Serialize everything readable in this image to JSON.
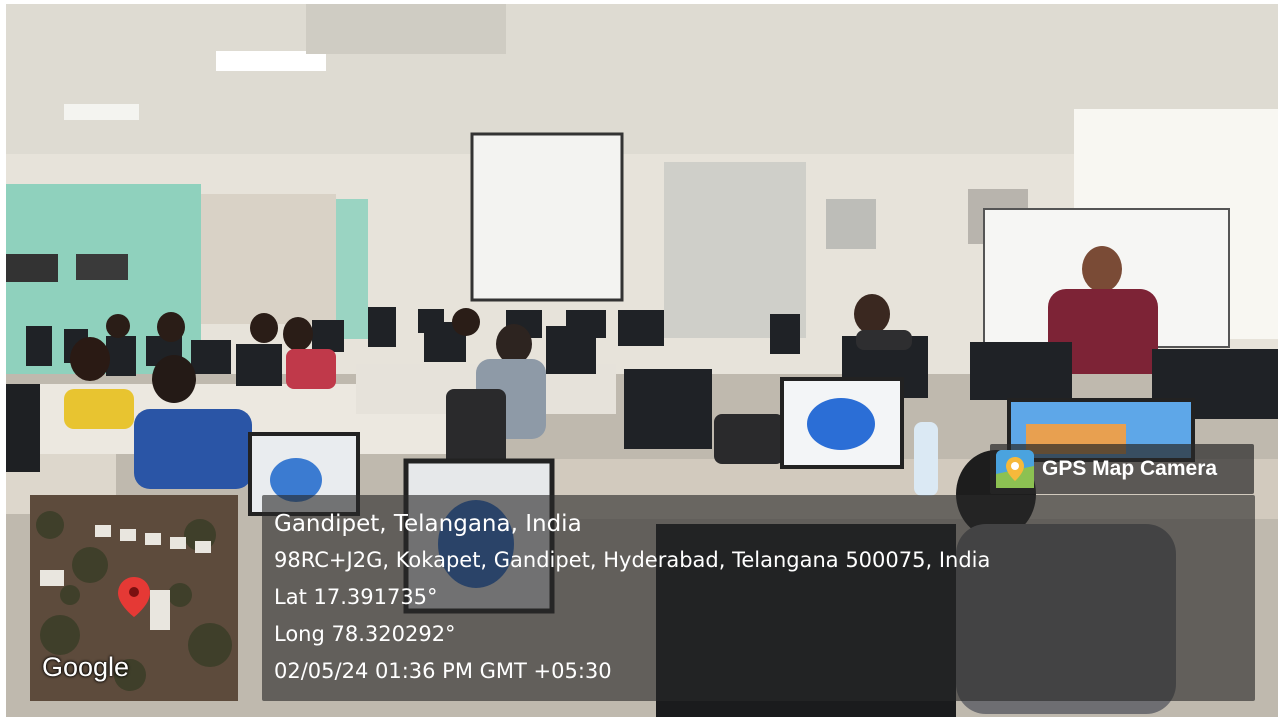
{
  "location": {
    "title": "Gandipet, Telangana, India",
    "address": "98RC+J2G, Kokapet, Gandipet, Hyderabad, Telangana 500075, India",
    "latitude": "Lat 17.391735°",
    "longitude": "Long 78.320292°",
    "timestamp": "02/05/24 01:36 PM GMT +05:30"
  },
  "map": {
    "provider_logo": "Google",
    "pin_icon": "map-pin-icon",
    "pin_color": "#e53935"
  },
  "badge": {
    "label": "GPS Map Camera",
    "icon": "gps-map-camera-app-icon"
  },
  "colors": {
    "overlay": "#282828",
    "text": "#ffffff",
    "wall_teal": "#8fd1bd"
  }
}
